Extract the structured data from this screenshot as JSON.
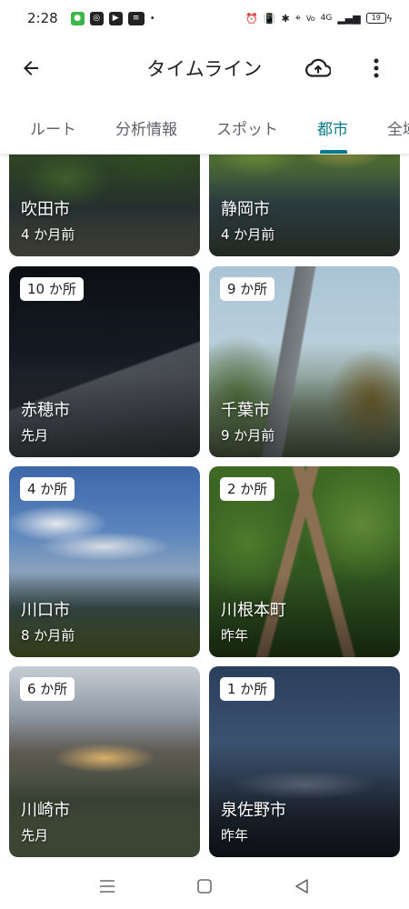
{
  "status_bar": {
    "time": "2:28",
    "network": "4G",
    "battery": "19"
  },
  "app_bar": {
    "title": "タイムライン"
  },
  "tabs": [
    {
      "label": "ルート"
    },
    {
      "label": "分析情報"
    },
    {
      "label": "スポット"
    },
    {
      "label": "都市"
    },
    {
      "label": "全域"
    }
  ],
  "active_tab": "都市",
  "cards": [
    {
      "city": "吹田市",
      "time": "4 か月前",
      "count": ""
    },
    {
      "city": "静岡市",
      "time": "4 か月前",
      "count": ""
    },
    {
      "city": "赤穂市",
      "time": "先月",
      "count": "10 か所"
    },
    {
      "city": "千葉市",
      "time": "9 か月前",
      "count": "9 か所"
    },
    {
      "city": "川口市",
      "time": "8 か月前",
      "count": "4 か所"
    },
    {
      "city": "川根本町",
      "time": "昨年",
      "count": "2 か所"
    },
    {
      "city": "川崎市",
      "time": "先月",
      "count": "6 か所"
    },
    {
      "city": "泉佐野市",
      "time": "昨年",
      "count": "1 か所"
    }
  ],
  "colors": {
    "accent": "#0b7a8b",
    "text": "#202124",
    "muted": "#5f6368"
  }
}
